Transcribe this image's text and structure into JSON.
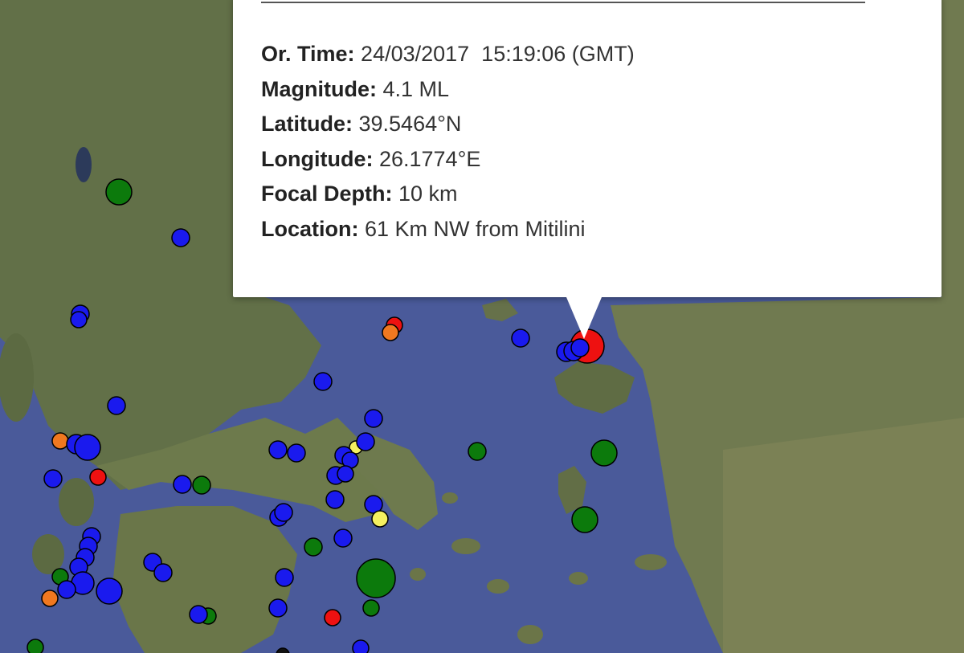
{
  "popup": {
    "rows": [
      {
        "label": "Or. Time:",
        "value": " 24/03/2017  15:19:06 (GMT)"
      },
      {
        "label": "Magnitude:",
        "value": " 4.1 ML"
      },
      {
        "label": "Latitude:",
        "value": " 39.5464°N"
      },
      {
        "label": "Longitude:",
        "value": " 26.1774°E"
      },
      {
        "label": "Focal Depth:",
        "value": " 10 km"
      },
      {
        "label": "Location:",
        "value": " 61 Km NW from Mitilini"
      }
    ]
  },
  "map": {
    "colors": {
      "sea": "#4a5a9a",
      "land": "#6b7a4a",
      "quake_red": "#ee1111",
      "quake_blue": "#1a1aee",
      "quake_green": "#0c7a0c",
      "quake_orange": "#f07820",
      "quake_yellow": "#f5f060"
    }
  }
}
